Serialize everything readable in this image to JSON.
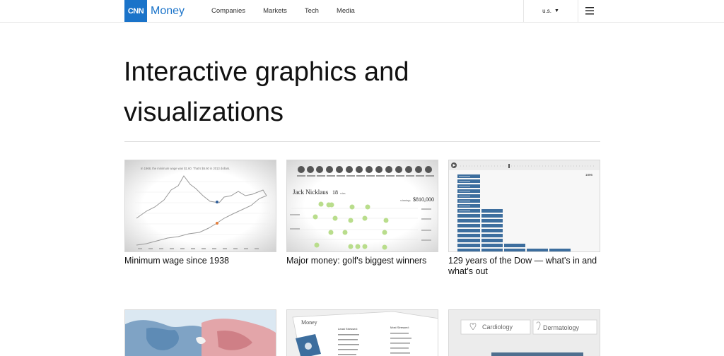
{
  "header": {
    "logo_mark": "CNN",
    "logo_text": "Money",
    "nav": [
      "Companies",
      "Markets",
      "Tech",
      "Media"
    ],
    "region": "u.s."
  },
  "page_title": "Interactive graphics and visualizations",
  "cards": [
    {
      "title": "Minimum wage since 1938"
    },
    {
      "title": "Major money: golf's biggest winners"
    },
    {
      "title": "129 years of the Dow — what's in and what's out"
    }
  ],
  "thumb_text": {
    "golf_name": "Jack Nicklaus",
    "golf_wins": "18",
    "golf_wins_unit": "wins",
    "golf_winnings_label": "winnings",
    "golf_winnings": "$810,000",
    "min_wage_caption": "In 1968, the minimum wage was $1.60. That's $6.60 in 2013 dollars.",
    "dow_year": "1896",
    "map_label": "Money",
    "map_list1_title": "Least Stressed:",
    "map_list2_title": "Most Stressed:",
    "tab_cardiology": "Cardiology",
    "tab_dermatology": "Dermatology"
  },
  "colors": {
    "brand": "#1a73c9",
    "dow_blue": "#3d6e9e",
    "golf_green": "#b9dd8c",
    "wage_orange": "#e47e3c"
  }
}
